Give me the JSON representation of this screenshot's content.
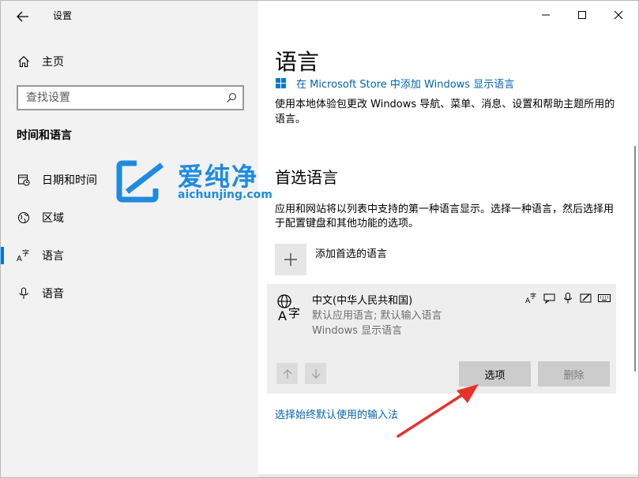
{
  "window": {
    "title": "设置",
    "controls": {
      "minimize": "minimize",
      "maximize": "maximize",
      "close": "close"
    }
  },
  "sidebar": {
    "home_label": "主页",
    "search_placeholder": "查找设置",
    "section_title": "时间和语言",
    "items": [
      {
        "label": "日期和时间",
        "icon": "calendar-clock-icon",
        "active": false
      },
      {
        "label": "区域",
        "icon": "globe-region-icon",
        "active": false
      },
      {
        "label": "语言",
        "icon": "language-icon",
        "active": true
      },
      {
        "label": "语音",
        "icon": "microphone-icon",
        "active": false
      }
    ]
  },
  "watermark": {
    "brand": "爱纯净",
    "url": "aichunjing.com",
    "color": "#1e8be0"
  },
  "main": {
    "title": "语言",
    "store_link": "在 Microsoft Store 中添加 Windows 显示语言",
    "description": "使用本地体验包更改 Windows 导航、菜单、消息、设置和帮助主题所用的语言。",
    "preferred_heading": "首选语言",
    "preferred_desc": "应用和网站将以列表中支持的第一种语言显示。选择一种语言，然后选择用于配置键盘和其他功能的选项。",
    "add_label": "添加首选的语言",
    "language": {
      "name": "中文(中华人民共和国)",
      "sub1": "默认应用语言; 默认输入语言",
      "sub2": "Windows 显示语言",
      "feature_icons": [
        "display-language-icon",
        "speech-icon",
        "microphone-icon",
        "handwriting-icon",
        "keyboard-icon"
      ]
    },
    "options_label": "选项",
    "remove_label": "删除",
    "input_method_link": "选择始终默认使用的输入法"
  },
  "colors": {
    "accent": "#0078d7",
    "link": "#0063b1",
    "annotation": "#e8312a"
  }
}
